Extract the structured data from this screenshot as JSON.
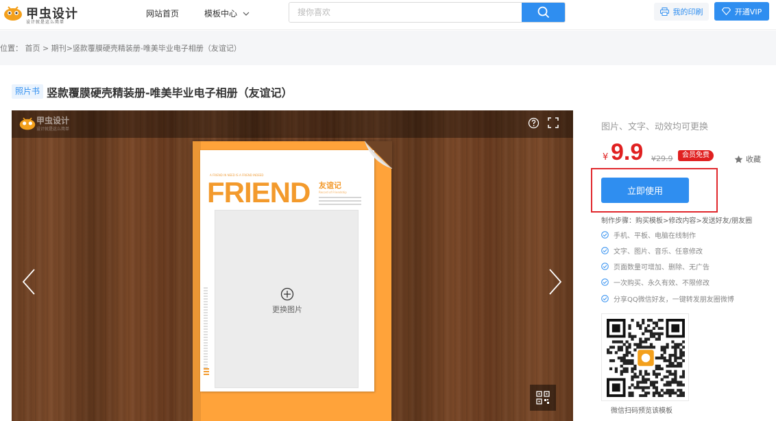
{
  "header": {
    "logo_text": "甲虫设计",
    "logo_sub": "设计就是这么简单",
    "nav": [
      {
        "label": "网站首页"
      },
      {
        "label": "模板中心"
      }
    ],
    "search_placeholder": "搜你喜欢",
    "print_label": "我的印刷",
    "vip_label": "开通VIP"
  },
  "breadcrumb": {
    "prefix": "位置：",
    "home": "首页",
    "sep": " >",
    "category": "期刊",
    "sep2": ">",
    "current": "竖款覆膜硬壳精装册-唯美毕业电子相册（友谊记）"
  },
  "page": {
    "tag": "照片书",
    "title": "竖款覆膜硬壳精装册-唯美毕业电子相册（友谊记）"
  },
  "preview": {
    "logo_text": "甲虫设计",
    "logo_sub": "设计就是这么简单",
    "cover": {
      "small_heading": "A FRIEND IN NEED IS A FRIEND INDEED",
      "big_word": "FRIEND",
      "cn_title": "友谊记",
      "cn_sub": "Record of Friendship",
      "replace_label": "更换图片"
    }
  },
  "sidebar": {
    "features_title": "图片、文字、动效均可更换",
    "currency": "¥",
    "price": "9.9",
    "old_price": "¥29.9",
    "vip_badge": "会员免费",
    "fav_label": "收藏",
    "use_button": "立即使用",
    "steps": "制作步骤：购买模板>修改内容>发送好友/朋友圈",
    "features": [
      "手机、平板、电脑在线制作",
      "文字、图片、音乐、任意修改",
      "页面数量可增加、删除、无广告",
      "一次购买、永久有效、不限修改",
      "分享QQ微信好友，一键转发朋友圈微博"
    ],
    "qr_caption": "微信扫码预览该模板"
  },
  "colors": {
    "accent": "#2f8ef0",
    "price": "#e02020",
    "highlight_border": "#e0262b",
    "book_orange": "#ffa33a"
  }
}
